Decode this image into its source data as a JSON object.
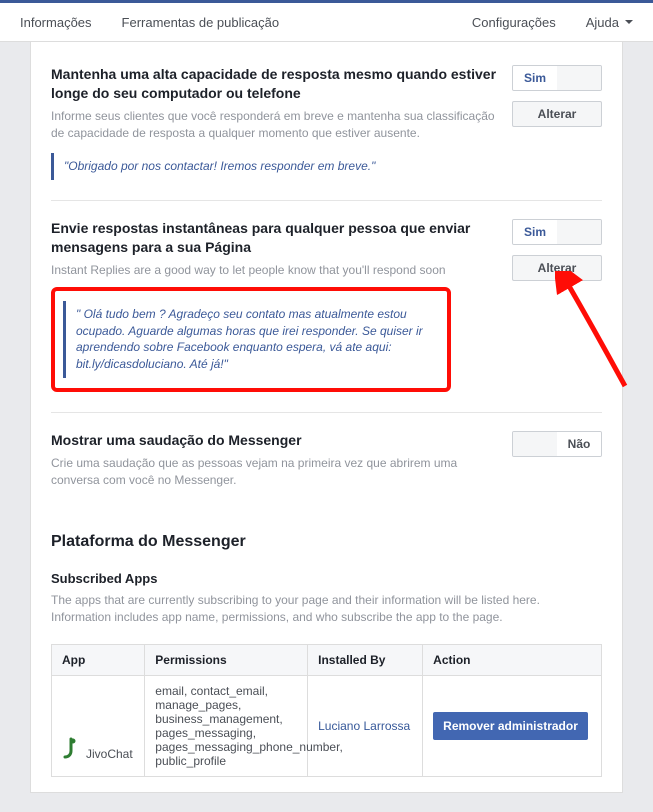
{
  "topbar": {
    "info": "Informações",
    "tools": "Ferramentas de publicação",
    "settings": "Configurações",
    "help": "Ajuda"
  },
  "section1": {
    "title": "Mantenha uma alta capacidade de resposta mesmo quando estiver longe do seu computador ou telefone",
    "desc": "Informe seus clientes que você responderá em breve e mantenha sua classificação de capacidade de resposta a qualquer momento que estiver ausente.",
    "quote": "\"Obrigado por nos contactar! Iremos responder em breve.\"",
    "toggle_yes": "Sim",
    "btn": "Alterar"
  },
  "section2": {
    "title": "Envie respostas instantâneas para qualquer pessoa que enviar mensagens para a sua Página",
    "desc": "Instant Replies are a good way to let people know that you'll respond soon",
    "quote": "\" Olá tudo bem ? Agradeço seu contato mas atualmente estou ocupado. Aguarde algumas horas que irei responder. Se quiser ir aprendendo sobre Facebook enquanto espera, vá ate aqui: bit.ly/dicasdoluciano. Até já!\"",
    "toggle_yes": "Sim",
    "btn": "Alterar"
  },
  "section3": {
    "title": "Mostrar uma saudação do Messenger",
    "desc": "Crie uma saudação que as pessoas vejam na primeira vez que abrirem uma conversa com você no Messenger.",
    "toggle_no": "Não"
  },
  "platform": {
    "title": "Plataforma do Messenger",
    "sub_title": "Subscribed Apps",
    "sub_desc": "The apps that are currently subscribing to your page and their information will be listed here. Information includes app name, permissions, and who subscribe the app to the page.",
    "cols": {
      "app": "App",
      "perm": "Permissions",
      "installed": "Installed By",
      "action": "Action"
    },
    "row": {
      "app": "JivoChat",
      "perm": "email, contact_email, manage_pages, business_management, pages_messaging, pages_messaging_phone_number, public_profile",
      "installed": "Luciano Larrossa",
      "action": "Remover administrador"
    }
  }
}
